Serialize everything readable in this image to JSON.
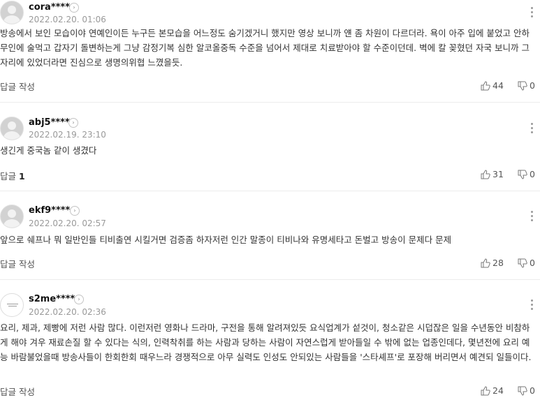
{
  "comments": [
    {
      "nickname": "cora****",
      "date": "2022.02.20. 01:06",
      "text": "방송에서 보인 모습이야 연예인이든 누구든 본모습을 어느정도 숨기겠거니 했지만 영상 보니까 얜 좀 차원이 다르더라. 욕이 아주 입에 붙었고 안하무인에 술먹고 갑자기 돌변하는게 그냥 감정기복 심한 알코올중독 수준을 넘어서 제대로 치료받아야 할 수준이던데. 벽에 칼 꽂혔던 자국 보니까 그자리에 있었더라면 진심으로 생명의위협 느꼈을듯.",
      "reply_label": "답글 작성",
      "reply_count": "",
      "likes": "44",
      "dislikes": "0"
    },
    {
      "nickname": "abj5****",
      "date": "2022.02.19. 23:10",
      "text": "생긴게 중국놈 같이 생겼다",
      "reply_label": "답글",
      "reply_count": "1",
      "likes": "31",
      "dislikes": "0"
    },
    {
      "nickname": "ekf9****",
      "date": "2022.02.20. 02:57",
      "text": "앞으로 쉐프나 뭐 일반인들 티비출연 시킬거면 검증좀 하자저런 인간 말종이 티비나와 유명세타고 돈벌고 방송이 문제다 문제",
      "reply_label": "답글 작성",
      "reply_count": "",
      "likes": "28",
      "dislikes": "0"
    },
    {
      "nickname": "s2me****",
      "date": "2022.02.20. 02:36",
      "text": "요리, 제과, 제빵에 저런 사람 많다. 이런저런 영화나 드라마, 구전을 통해 알려져있듯 요식업계가 섵것이, 청소같은 시덥잖은 일을 수년동안 비참하게 해야 겨우 재료손질 할 수 있다는 식의, 인력착취를 하는 사람과 당하는 사람이 자연스럽게 받아들일 수 밖에 없는 업종인데다, 몇년전에 요리 예능 바람불었을때 방송사들이 한회한회 때우느라 경쟁적으로 아무 실력도 인성도 안되있는 사람들을 '스타셰프'로 포장해 버리면서 예견되 일들이다.",
      "reply_label": "답글 작성",
      "reply_count": "",
      "likes": "24",
      "dislikes": "0"
    }
  ]
}
